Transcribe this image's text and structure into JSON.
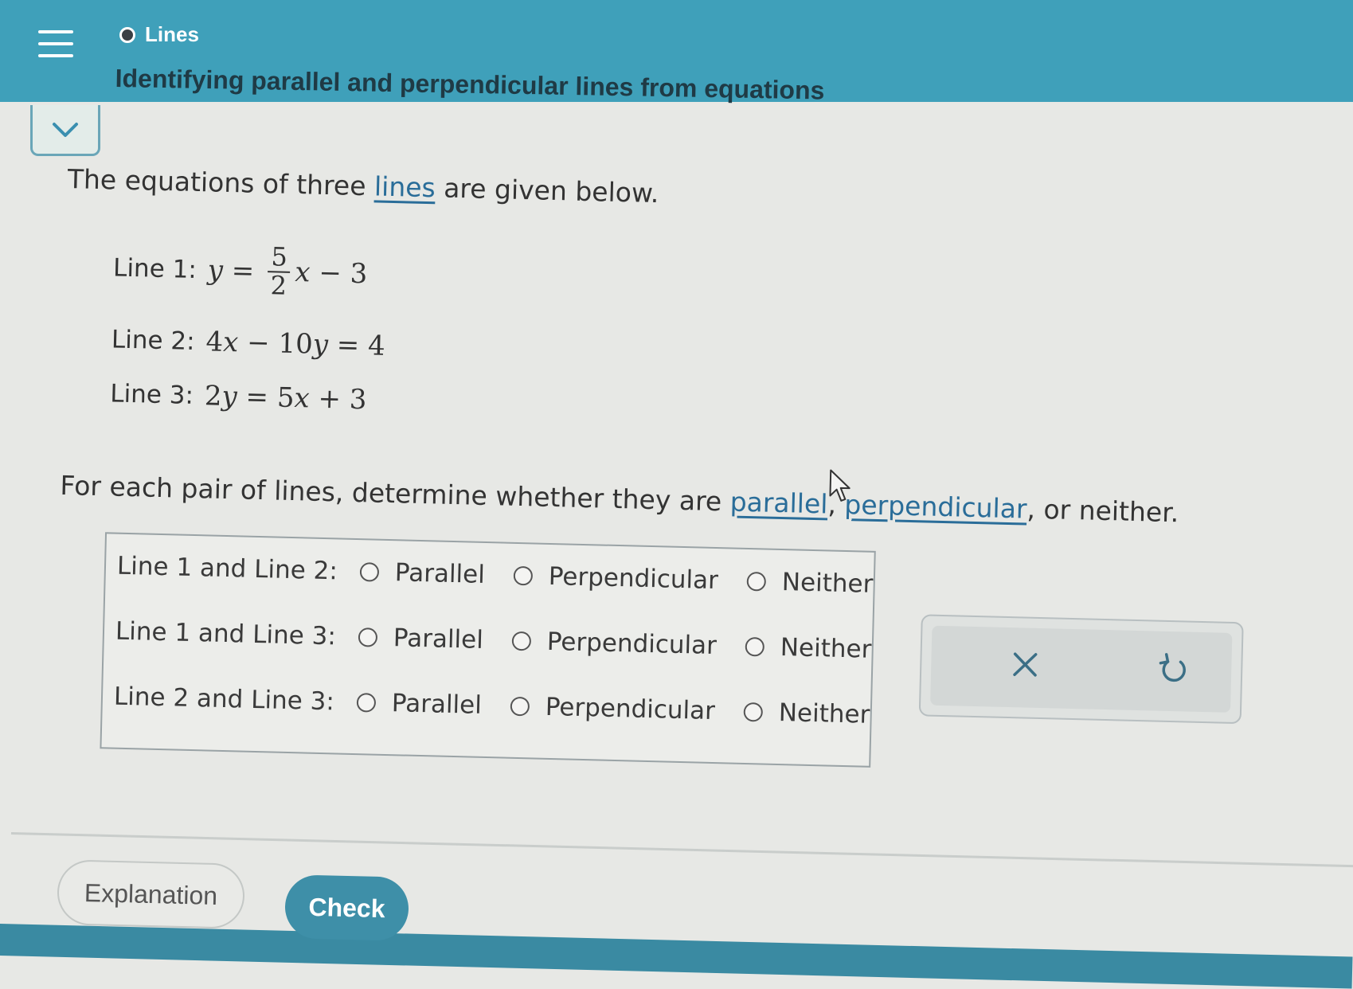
{
  "header": {
    "topic_label": "Lines",
    "lesson_title": "Identifying parallel and perpendicular lines from equations",
    "menu_icon": "hamburger-menu-icon",
    "collapse_icon": "chevron-down-icon",
    "background_color": "#3fa0ba"
  },
  "problem": {
    "intro_before": "The equations of three ",
    "intro_link": "lines",
    "intro_after": " are given below.",
    "equations": [
      {
        "label": "Line 1:",
        "latex": "y = (5/2)x - 3"
      },
      {
        "label": "Line 2:",
        "latex": "4x - 10y = 4"
      },
      {
        "label": "Line 3:",
        "latex": "2y = 5x + 3"
      }
    ],
    "question_before": "For each pair of lines, determine whether they are ",
    "question_link1": "parallel",
    "question_sep": ", ",
    "question_link2": "perpendicular",
    "question_after": ", or neither."
  },
  "answers": {
    "rows": [
      {
        "label": "Line 1 and Line 2:",
        "options": [
          "Parallel",
          "Perpendicular",
          "Neither"
        ]
      },
      {
        "label": "Line 1 and Line 3:",
        "options": [
          "Parallel",
          "Perpendicular",
          "Neither"
        ]
      },
      {
        "label": "Line 2 and Line 3:",
        "options": [
          "Parallel",
          "Perpendicular",
          "Neither"
        ]
      }
    ]
  },
  "tools": {
    "clear_icon": "close-x-icon",
    "undo_icon": "undo-icon"
  },
  "footer": {
    "explanation_label": "Explanation",
    "check_label": "Check",
    "check_color": "#3e8fa8"
  }
}
